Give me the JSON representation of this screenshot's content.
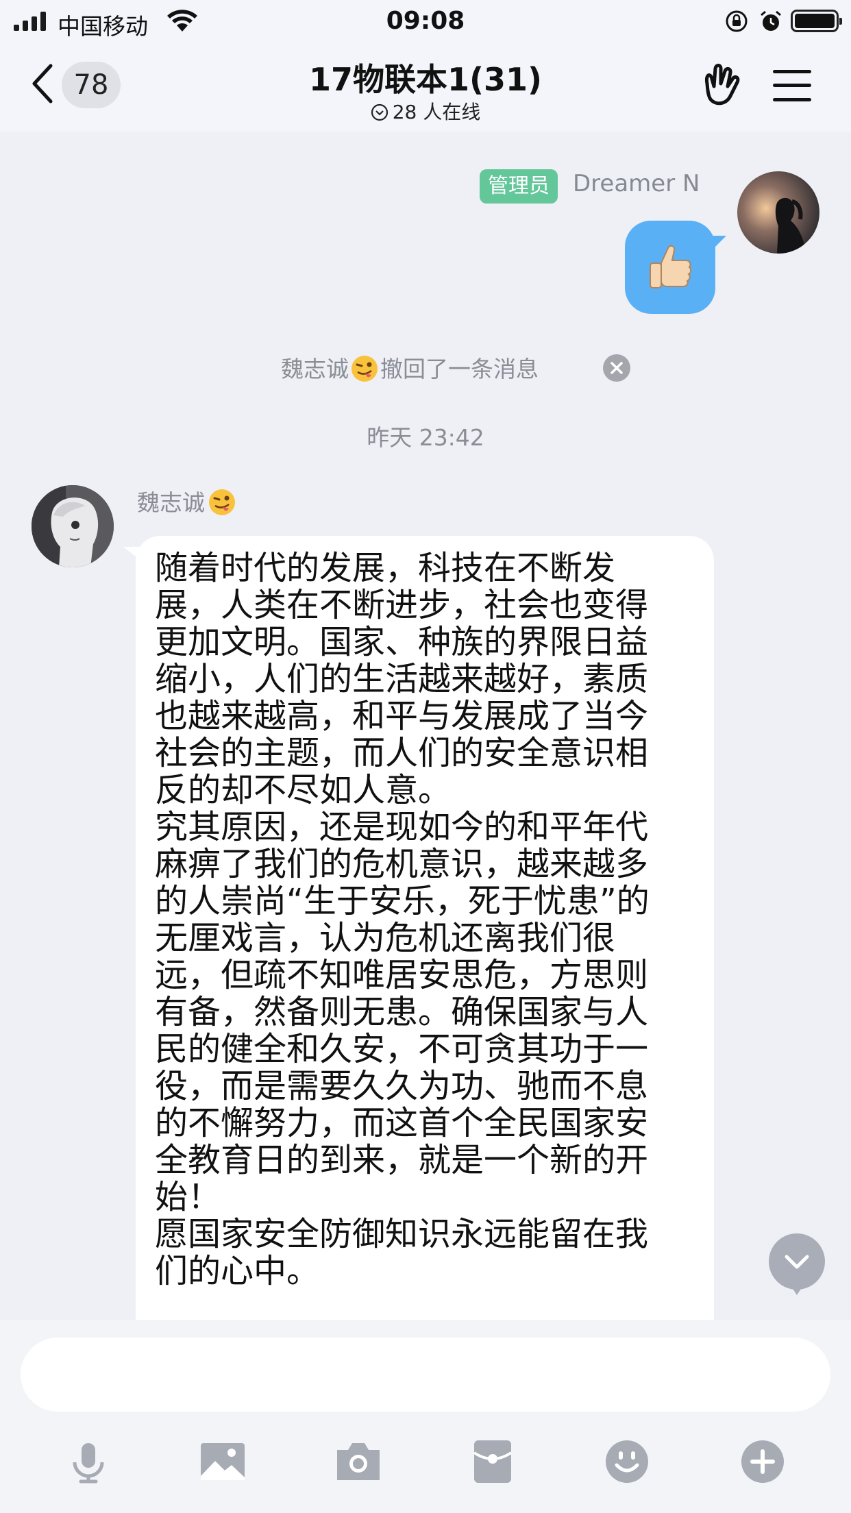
{
  "status_bar": {
    "carrier": "中国移动",
    "time": "09:08"
  },
  "nav": {
    "back_badge": "78",
    "title": "17物联本1(31)",
    "online_text": "28 人在线"
  },
  "messages": {
    "outgoing": {
      "admin_tag": "管理员",
      "sender": "Dreamer  N",
      "content_icon": "thumbs-up-emoji"
    },
    "recall_notice": {
      "name": "魏志诚",
      "text": "撤回了一条消息"
    },
    "timestamp": "昨天 23:42",
    "incoming": {
      "sender": "魏志诚",
      "text": "随着时代的发展，科技在不断发\n展，人类在不断进步，社会也变得\n更加文明。国家、种族的界限日益\n缩小，人们的生活越来越好，素质\n也越来越高，和平与发展成了当今\n社会的主题，而人们的安全意识相\n反的却不尽如人意。\n究其原因，还是现如今的和平年代\n麻痹了我们的危机意识，越来越多\n的人崇尚“生于安乐，死于忧患”的\n无厘戏言，认为危机还离我们很\n远，但疏不知唯居安思危，方思则\n有备，然备则无患。确保国家与人\n民的健全和久安，不可贪其功于一\n役，而是需要久久为功、驰而不息\n的不懈努力，而这首个全民国家安\n全教育日的到来，就是一个新的开\n始！\n愿国家安全防御知识永远能留在我\n们的心中。"
    }
  },
  "input": {
    "placeholder": ""
  },
  "toolbar": {
    "icons": [
      "microphone-icon",
      "image-icon",
      "camera-icon",
      "red-packet-icon",
      "emoji-icon",
      "plus-icon"
    ]
  },
  "colors": {
    "accent_blue": "#5ab0f5",
    "admin_green": "#63c79a",
    "background": "#eef0f5",
    "icon_gray": "#a7abb4"
  }
}
